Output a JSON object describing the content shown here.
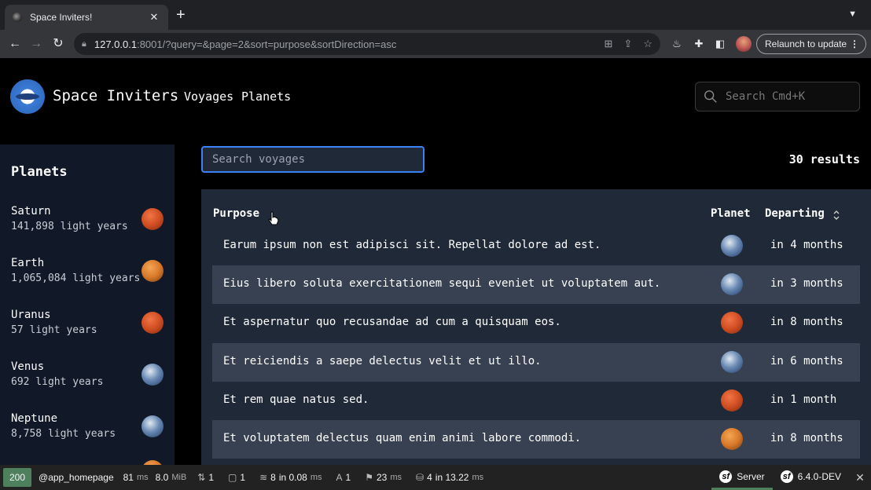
{
  "browser": {
    "tab_title": "Space Inviters!",
    "tab_close": "✕",
    "new_tab": "+",
    "url_host": "127.0.0.1",
    "url_rest": ":8001/?query=&page=2&sort=purpose&sortDirection=asc",
    "relaunch_label": "Relaunch to update"
  },
  "header": {
    "brand": "Space Inviters",
    "nav": [
      "Voyages",
      "Planets"
    ],
    "search_placeholder": "Search Cmd+K"
  },
  "sidebar": {
    "title": "Planets",
    "items": [
      {
        "name": "Saturn",
        "distance": "141,898 light years",
        "image": "red"
      },
      {
        "name": "Earth",
        "distance": "1,065,084 light years",
        "image": "earth"
      },
      {
        "name": "Uranus",
        "distance": "57 light years",
        "image": "red"
      },
      {
        "name": "Venus",
        "distance": "692 light years",
        "image": "blue"
      },
      {
        "name": "Neptune",
        "distance": "8,758 light years",
        "image": "blue"
      }
    ]
  },
  "main": {
    "search_placeholder": "Search voyages",
    "results": "30 results",
    "columns": {
      "purpose": "Purpose",
      "planet": "Planet",
      "departing": "Departing"
    },
    "rows": [
      {
        "purpose": "Earum ipsum non est adipisci sit. Repellat dolore ad est.",
        "planet_image": "blue",
        "departing": "in 4 months"
      },
      {
        "purpose": "Eius libero soluta exercitationem sequi eveniet ut voluptatem aut.",
        "planet_image": "blue",
        "departing": "in 3 months"
      },
      {
        "purpose": "Et aspernatur quo recusandae ad cum a quisquam eos.",
        "planet_image": "red",
        "departing": "in 8 months"
      },
      {
        "purpose": "Et reiciendis a saepe delectus velit et ut illo.",
        "planet_image": "blue",
        "departing": "in 6 months"
      },
      {
        "purpose": "Et rem quae natus sed.",
        "planet_image": "red",
        "departing": "in 1 month"
      },
      {
        "purpose": "Et voluptatem delectus quam enim animi labore commodi.",
        "planet_image": "earth",
        "departing": "in 8 months"
      }
    ]
  },
  "profiler": {
    "status": "200",
    "route": "@app_homepage",
    "time_value": "81",
    "time_unit": "ms",
    "memory_value": "8.0",
    "memory_unit": "MiB",
    "requests": "1",
    "forms": "1",
    "cache_value": "8",
    "cache_in": "in 0.08",
    "cache_unit": "ms",
    "translations": "1",
    "security_value": "23",
    "security_unit": "ms",
    "db_value": "4",
    "db_in": "in 13.22",
    "db_unit": "ms",
    "server_label": "Server",
    "version": "6.4.0-DEV"
  },
  "colors": {
    "accent": "#3b82f6",
    "panel": "#1f2937",
    "row_alt": "#374151",
    "sidebar": "#111827",
    "status_ok": "#4f805d"
  }
}
